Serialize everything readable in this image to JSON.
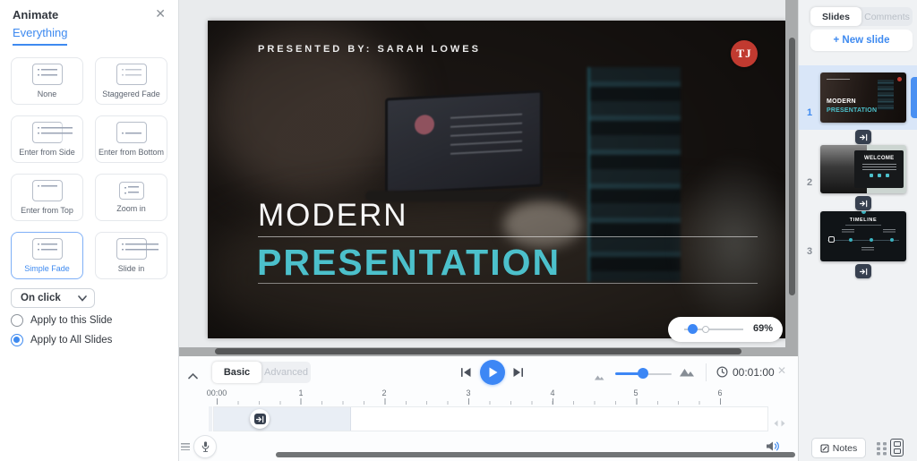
{
  "colors": {
    "accent": "#3e8af0",
    "teal": "#4cc0cb",
    "logo_red": "#c13a30",
    "play_blue": "#3d87f5"
  },
  "animate_panel": {
    "title": "Animate",
    "close_icon": "✕",
    "tab": "Everything",
    "options": [
      {
        "label": "None",
        "selected": false
      },
      {
        "label": "Staggered Fade",
        "selected": false
      },
      {
        "label": "Enter from Side",
        "selected": false
      },
      {
        "label": "Enter from Bottom",
        "selected": false
      },
      {
        "label": "Enter from Top",
        "selected": false
      },
      {
        "label": "Zoom in",
        "selected": false
      },
      {
        "label": "Simple Fade",
        "selected": true
      },
      {
        "label": "Slide in",
        "selected": false
      }
    ],
    "trigger_value": "On click",
    "apply_options": [
      {
        "label": "Apply to this Slide",
        "selected": false
      },
      {
        "label": "Apply to All Slides",
        "selected": true
      }
    ]
  },
  "slide": {
    "presented_by": "PRESENTED BY: SARAH LOWES",
    "logo": "TJ",
    "title_line1": "MODERN",
    "title_line2": "PRESENTATION"
  },
  "canvas": {
    "zoom_percent": "69%"
  },
  "timeline": {
    "tabs": [
      {
        "label": "Basic",
        "active": true
      },
      {
        "label": "Advanced",
        "active": false
      }
    ],
    "duration": "00:01:00",
    "close_icon": "✕",
    "ruler": [
      "00:00",
      "1",
      "2",
      "3",
      "4",
      "5",
      "6"
    ]
  },
  "slides_panel": {
    "tabs": [
      {
        "label": "Slides",
        "active": true
      },
      {
        "label": "Comments",
        "active": false
      }
    ],
    "new_slide_label": "+ New slide",
    "slides": [
      {
        "number": "1",
        "title1": "MODERN",
        "title2": "PRESENTATION",
        "selected": true
      },
      {
        "number": "2",
        "title": "WELCOME",
        "selected": false
      },
      {
        "number": "3",
        "title": "TIMELINE",
        "selected": false
      }
    ],
    "notes_label": "Notes"
  }
}
